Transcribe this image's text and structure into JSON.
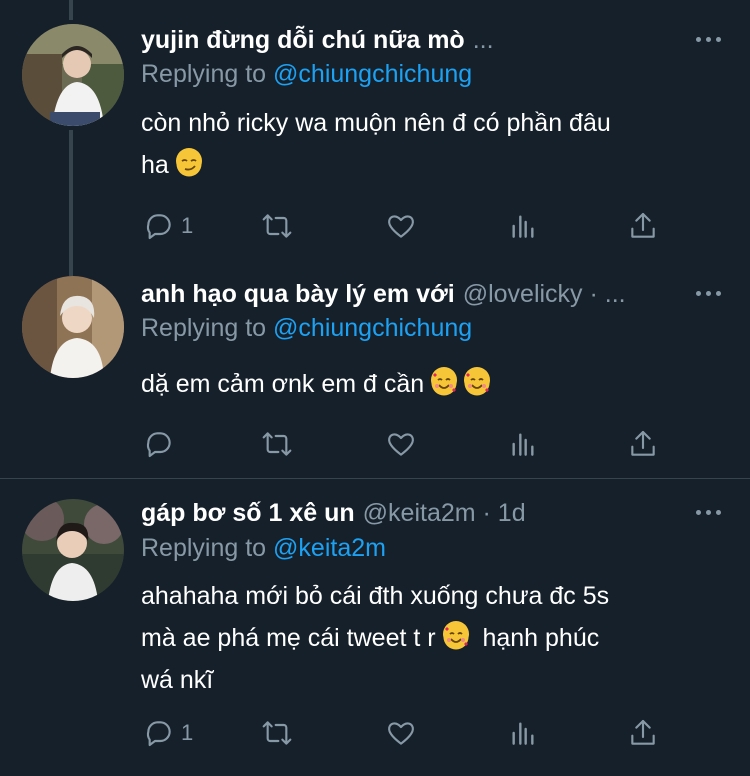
{
  "colors": {
    "background": "#15202b",
    "text_primary": "#ffffff",
    "text_secondary": "#8899a6",
    "mention": "#1da1f2",
    "thread_line": "#38444d"
  },
  "tweets": [
    {
      "name": "yujin đừng dỗi chú nữa mò",
      "name_suffix": "...",
      "handle": "",
      "time": "",
      "replying_prefix": "Replying to",
      "replying_to": "@chiungchichung",
      "text_lines": [
        "còn nhỏ ricky wa muộn nên đ có phần đâu",
        "ha"
      ],
      "emoji": [
        "smirking-face"
      ],
      "reply_count": "1",
      "retweet_count": "",
      "like_count": "",
      "icons": [
        "reply-icon",
        "retweet-icon",
        "like-icon",
        "analytics-icon",
        "share-icon"
      ]
    },
    {
      "name": "anh hạo qua bày lý em với",
      "handle": "@lovelicky · ...",
      "time": "",
      "replying_prefix": "Replying to",
      "replying_to": "@chiungchichung",
      "text_lines": [
        "dặ em cảm ơnk em đ cần"
      ],
      "emoji": [
        "smiling-face-with-hearts",
        "smiling-face-with-hearts"
      ],
      "reply_count": "",
      "retweet_count": "",
      "like_count": "",
      "icons": [
        "reply-icon",
        "retweet-icon",
        "like-icon",
        "analytics-icon",
        "share-icon"
      ]
    },
    {
      "name": "gáp bơ số 1 xê un",
      "handle": "@keita2m · 1d",
      "time": "1d",
      "replying_prefix": "Replying to",
      "replying_to": "@keita2m",
      "text_lines": [
        "ahahaha mới bỏ cái đth xuống chưa đc 5s",
        "mà ae phá mẹ cái tweet t r",
        "hạnh phúc",
        "wá nkĩ"
      ],
      "emoji": [
        "smiling-face-with-hearts"
      ],
      "reply_count": "1",
      "retweet_count": "",
      "like_count": "",
      "icons": [
        "reply-icon",
        "retweet-icon",
        "like-icon",
        "analytics-icon",
        "share-icon"
      ]
    }
  ]
}
